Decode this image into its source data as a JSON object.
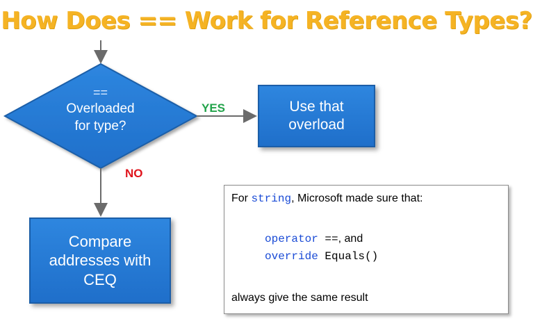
{
  "title": "How Does == Work for Reference Types?",
  "diamond": {
    "line1": "==",
    "line2": "Overloaded",
    "line3": "for type?"
  },
  "edges": {
    "yes_label": "YES",
    "no_label": "NO"
  },
  "box_use": {
    "line1": "Use that",
    "line2": "overload"
  },
  "box_compare": {
    "line1": "Compare",
    "line2": "addresses with",
    "line3": "CEQ"
  },
  "note": {
    "intro_prefix": "For ",
    "intro_keyword": "string",
    "intro_suffix": ", Microsoft made sure that:",
    "code1_keyword": "operator",
    "code1_rest": " ==",
    "code1_suffix": ", and",
    "code2_keyword": "override",
    "code2_rest": " Equals()",
    "closing": "always give the same result"
  },
  "colors": {
    "title": "#f5b324",
    "node_blue": "#2679d6",
    "yes_green": "#22a34a",
    "no_red": "#e0141c",
    "code_keyword": "#1a4bd6"
  }
}
